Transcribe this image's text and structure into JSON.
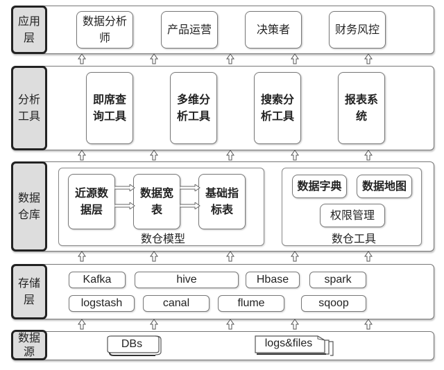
{
  "layers": {
    "application": {
      "label": "应用层",
      "label_lines": [
        "应用",
        "层"
      ],
      "items": [
        {
          "lines": [
            "数据分析",
            "师"
          ]
        },
        {
          "lines": [
            "产品运营"
          ]
        },
        {
          "lines": [
            "决策者"
          ]
        },
        {
          "lines": [
            "财务风控"
          ]
        }
      ]
    },
    "analysis_tools": {
      "label_lines": [
        "分析",
        "工具"
      ],
      "items": [
        {
          "lines": [
            "即席查",
            "询工具"
          ]
        },
        {
          "lines": [
            "多维分",
            "析工具"
          ]
        },
        {
          "lines": [
            "搜索分",
            "析工具"
          ]
        },
        {
          "lines": [
            "报表系",
            "统"
          ]
        }
      ]
    },
    "data_warehouse": {
      "label_lines": [
        "数据",
        "仓库"
      ],
      "model_group": {
        "caption": "数仓模型",
        "items": [
          {
            "lines": [
              "近源数",
              "据层"
            ]
          },
          {
            "lines": [
              "数据宽",
              "表"
            ]
          },
          {
            "lines": [
              "基础指",
              "标表"
            ]
          }
        ]
      },
      "tools_group": {
        "caption": "数仓工具",
        "items": [
          {
            "lines": [
              "数据字典"
            ]
          },
          {
            "lines": [
              "数据地图"
            ]
          },
          {
            "lines": [
              "权限管理"
            ]
          }
        ]
      }
    },
    "storage": {
      "label_lines": [
        "存储",
        "层"
      ],
      "row1": [
        "Kafka",
        "hive",
        "Hbase",
        "spark"
      ],
      "row2": [
        "logstash",
        "canal",
        "flume",
        "sqoop"
      ]
    },
    "data_source": {
      "label_lines": [
        "数据",
        "源"
      ],
      "items": [
        {
          "label": "DBs",
          "icon": "database-icon"
        },
        {
          "label": "logs&files",
          "icon": "files-icon"
        }
      ]
    }
  }
}
